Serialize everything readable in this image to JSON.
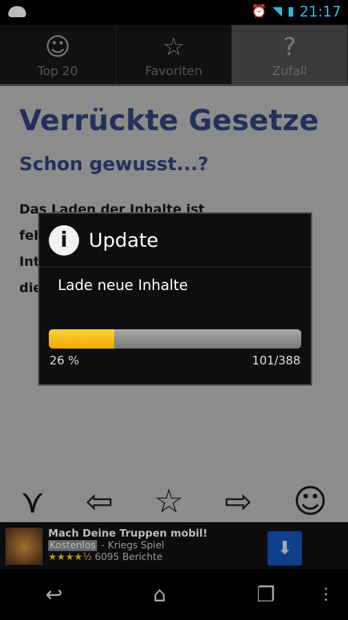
{
  "status_bar": {
    "time": "21:17",
    "icons": [
      "android-icon",
      "alarm-icon",
      "wifi-icon",
      "signal-icon",
      "battery-charging-icon"
    ]
  },
  "tabs": [
    {
      "label": "Top 20",
      "icon": "smiley-icon"
    },
    {
      "label": "Favoriten",
      "icon": "star-icon"
    },
    {
      "label": "Zufall",
      "icon": "question-icon",
      "active": true
    }
  ],
  "content": {
    "title": "Verrückte Gesetze",
    "subtitle": "Schon gewusst...?",
    "body": "Das Laden der Inhalte ist fehlgeschlagen. Bitte Internetverbindung überprüfen und die App neu starten."
  },
  "dialog": {
    "title": "Update",
    "message": "Lade neue Inhalte",
    "progress_percent": 26,
    "percent_label": "26 %",
    "count_label": "101/388",
    "colors": {
      "fill": "#f5b800",
      "track": "#8a8a8a"
    }
  },
  "ad": {
    "title": "Mach Deine Truppen mobil!",
    "badge": "Kostenlos",
    "category": "- Kriegs Spiel",
    "rating": 4.5,
    "stars": "★★★★½",
    "reviews": "6095 Berichte"
  }
}
